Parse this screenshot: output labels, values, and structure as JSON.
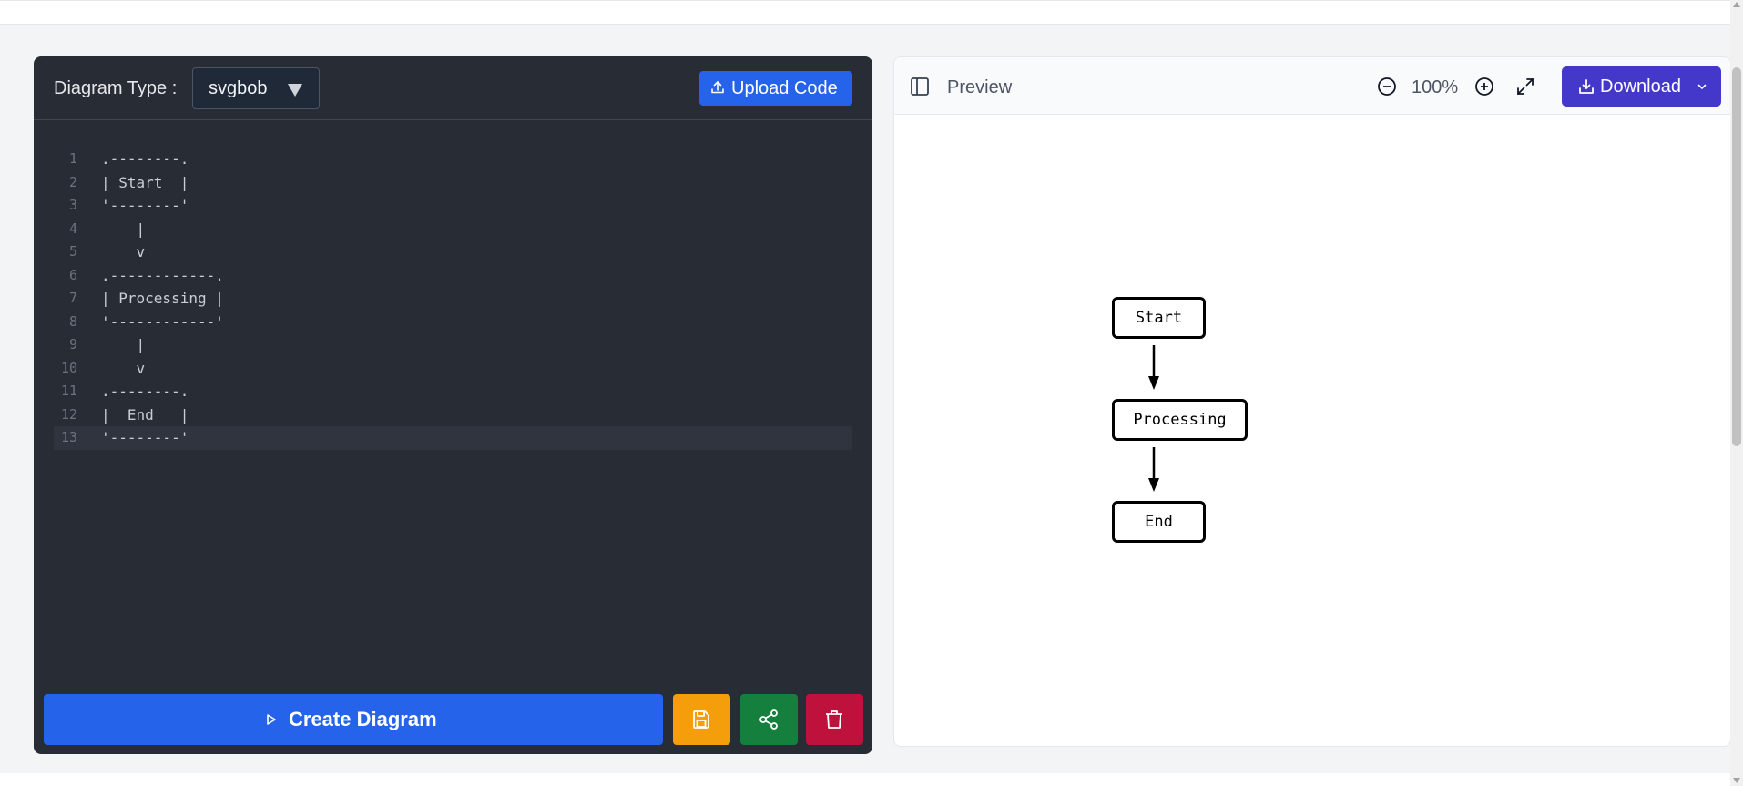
{
  "editor": {
    "type_label": "Diagram Type :",
    "diagram_type": "svgbob",
    "upload_label": "Upload Code",
    "lines": [
      {
        "n": "1",
        "text": ".--------."
      },
      {
        "n": "2",
        "text": "| Start  |"
      },
      {
        "n": "3",
        "text": "'--------'"
      },
      {
        "n": "4",
        "text": "    |"
      },
      {
        "n": "5",
        "text": "    v"
      },
      {
        "n": "6",
        "text": ".------------."
      },
      {
        "n": "7",
        "text": "| Processing |"
      },
      {
        "n": "8",
        "text": "'------------'"
      },
      {
        "n": "9",
        "text": "    |"
      },
      {
        "n": "10",
        "text": "    v"
      },
      {
        "n": "11",
        "text": ".--------."
      },
      {
        "n": "12",
        "text": "|  End   |"
      },
      {
        "n": "13",
        "text": "'--------'"
      }
    ],
    "create_label": "Create Diagram"
  },
  "preview": {
    "title": "Preview",
    "zoom": "100%",
    "download_label": "Download"
  },
  "diagram": {
    "nodes": [
      "Start",
      "Processing",
      "End"
    ]
  },
  "colors": {
    "editor_bg": "#282c34",
    "primary": "#2563eb",
    "save": "#f59e0b",
    "share": "#15803d",
    "delete": "#be123c",
    "download": "#4338ca"
  },
  "icons": {
    "upload": "upload-icon",
    "create": "play-icon",
    "save": "floppy-disk-icon",
    "share": "share-nodes-icon",
    "delete": "trash-icon",
    "sidebar": "sidebar-toggle-icon",
    "zoom_out": "zoom-out-icon",
    "zoom_in": "zoom-in-icon",
    "fullscreen": "expand-icon",
    "download": "download-icon"
  }
}
